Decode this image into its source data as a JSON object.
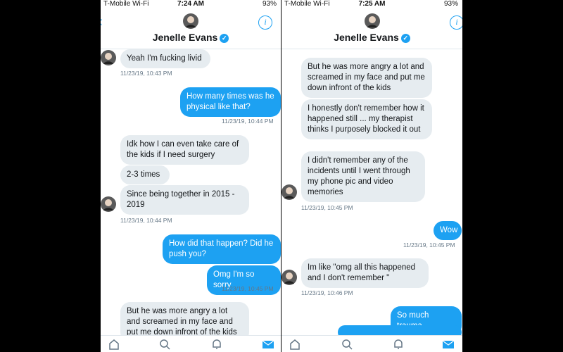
{
  "contact_name": "Jenelle Evans",
  "colors": {
    "accent": "#1da1f2",
    "incoming_bg": "#e6ecf0",
    "text": "#14171a",
    "meta": "#657786"
  },
  "left": {
    "status": {
      "carrier": "T-Mobile Wi-Fi",
      "time": "7:24 AM",
      "battery": "93%"
    },
    "messages": {
      "m1": "Yeah I'm fucking livid",
      "t1": "11/23/19, 10:43 PM",
      "m2": "How many times was he physical like that?",
      "t2": "11/23/19, 10:44 PM",
      "m3": "Idk how I can even take care of the kids if I need surgery",
      "m4": "2-3 times",
      "m5": "Since being together in 2015 - 2019",
      "t3": "11/23/19, 10:44 PM",
      "m6": "How did that happen? Did he push you?",
      "m7": "Omg I'm so sorry",
      "t4": "11/23/19, 10:45 PM",
      "m8": "But he was more angry a lot and screamed in my face and put me down infront of the kids"
    }
  },
  "right": {
    "status": {
      "carrier": "T-Mobile Wi-Fi",
      "time": "7:25 AM",
      "battery": "93%"
    },
    "messages": {
      "m1": "But he was more angry a lot and screamed in my face and put me down infront of the kids",
      "m2": "I honestly don't remember how it happened still ... my therapist thinks I purposely blocked it out",
      "m3": "I didn't remember any of the incidents until I went through my phone pic and video memories",
      "t1": "11/23/19, 10:45 PM",
      "m4": "Wow",
      "t2": "11/23/19, 10:45 PM",
      "m5": "Im like \"omg all this happened and I don't remember \"",
      "t3": "11/23/19, 10:46 PM",
      "m6": "So much trauma"
    }
  }
}
